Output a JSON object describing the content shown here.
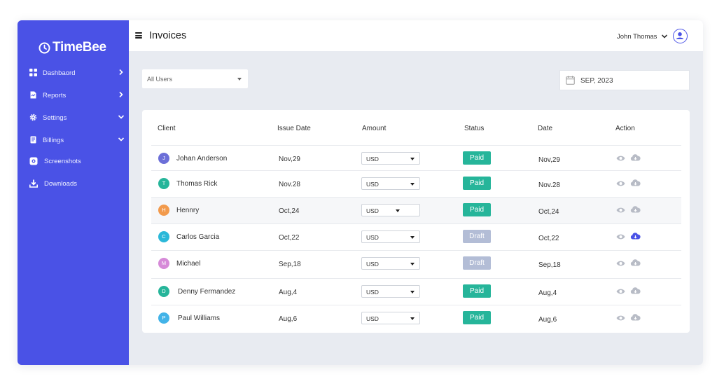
{
  "app": {
    "logo_text": "TimeBee"
  },
  "sidebar": {
    "items": [
      {
        "label": "Dashbaord",
        "icon": "dashboard-grid-icon",
        "arrow": "right"
      },
      {
        "label": "Reports",
        "icon": "report-document-icon",
        "arrow": "right"
      },
      {
        "label": "Settings",
        "icon": "gear-icon",
        "arrow": "down"
      },
      {
        "label": "Billings",
        "icon": "billing-document-icon",
        "arrow": "down"
      },
      {
        "label": "Screenshots",
        "icon": "screenshot-icon",
        "arrow": ""
      },
      {
        "label": "Downloads",
        "icon": "download-icon",
        "arrow": ""
      }
    ]
  },
  "header": {
    "title": "Invoices",
    "user_name": "John Thomas"
  },
  "filters": {
    "user_select": "All Users",
    "date_value": "SEP, 2023"
  },
  "table": {
    "columns": [
      "Client",
      "Issue Date",
      "Amount",
      "Status",
      "Date",
      "Action"
    ],
    "rows": [
      {
        "initial": "J",
        "client": "Johan Anderson",
        "issue_date": "Nov,29",
        "currency": "USD",
        "status": "Paid",
        "date": "Nov,29"
      },
      {
        "initial": "T",
        "client": "Thomas Rick",
        "issue_date": "Nov.28",
        "currency": "USD",
        "status": "Paid",
        "date": "Nov.28"
      },
      {
        "initial": "H",
        "client": "Hennry",
        "issue_date": "Oct,24",
        "currency": "USD",
        "status": "Paid",
        "date": "Oct,24"
      },
      {
        "initial": "C",
        "client": "Carlos Garcia",
        "issue_date": "Oct,22",
        "currency": "USD",
        "status": "Draft",
        "date": "Oct,22"
      },
      {
        "initial": "M",
        "client": "Michael",
        "issue_date": "Sep,18",
        "currency": "USD",
        "status": "Draft",
        "date": "Sep,18"
      },
      {
        "initial": "D",
        "client": "Denny Fermandez",
        "issue_date": "Aug,4",
        "currency": "USD",
        "status": "Paid",
        "date": "Aug,4"
      },
      {
        "initial": "P",
        "client": "Paul Williams",
        "issue_date": "Aug,6",
        "currency": "USD",
        "status": "Paid",
        "date": "Aug,6"
      }
    ]
  },
  "colors": {
    "sidebar_bg": "#4a52e6",
    "paid": "#26b59a",
    "draft": "#b3bdd6",
    "avatar_j": "#6c6fd8",
    "avatar_t": "#26b59a",
    "avatar_h": "#f29a4c",
    "avatar_c": "#2bb8d9",
    "avatar_m": "#d68ad8",
    "avatar_d": "#26b59a",
    "avatar_p": "#42b3e8",
    "action_icon": "#b8bcc6",
    "action_icon_active": "#4a52e6"
  }
}
